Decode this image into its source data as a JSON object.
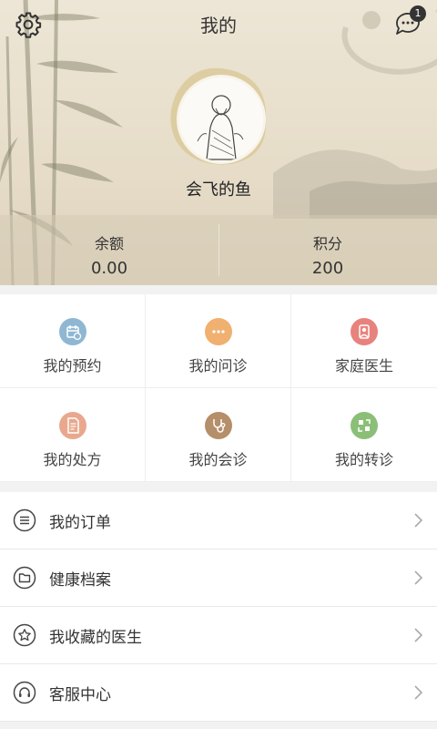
{
  "header": {
    "title": "我的",
    "message_badge": "1",
    "username": "会飞的鱼"
  },
  "stats": [
    {
      "label": "余额",
      "value": "0.00"
    },
    {
      "label": "积分",
      "value": "200"
    }
  ],
  "grid": [
    {
      "label": "我的预约",
      "icon": "calendar-icon",
      "color": "#8fb7d3"
    },
    {
      "label": "我的问诊",
      "icon": "chat-dots-icon",
      "color": "#f0b070"
    },
    {
      "label": "家庭医生",
      "icon": "doctor-icon",
      "color": "#e8827d"
    },
    {
      "label": "我的处方",
      "icon": "prescription-icon",
      "color": "#e9a88e"
    },
    {
      "label": "我的会诊",
      "icon": "stethoscope-icon",
      "color": "#b58e6a"
    },
    {
      "label": "我的转诊",
      "icon": "transfer-icon",
      "color": "#8bbf78"
    }
  ],
  "list": [
    {
      "label": "我的订单",
      "icon": "list-icon"
    },
    {
      "label": "健康档案",
      "icon": "folder-icon"
    },
    {
      "label": "我收藏的医生",
      "icon": "star-icon"
    },
    {
      "label": "客服中心",
      "icon": "headset-icon"
    }
  ]
}
